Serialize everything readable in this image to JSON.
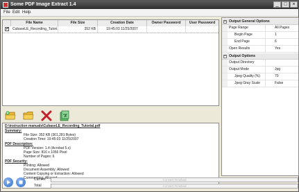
{
  "window": {
    "title": "Some PDF Image Extract 1.4"
  },
  "menu": [
    "File",
    "Edit",
    "Help"
  ],
  "grid": {
    "columns": [
      "File Name",
      "File Size",
      "Creation Date",
      "Owner Password",
      "User Password"
    ],
    "rows": [
      {
        "checked": true,
        "file_name": "CubaseLE_Recording_Tutori...",
        "file_size": "352 KB",
        "creation_date": "19:45:03 11/25/2007",
        "owner_password": "",
        "user_password": ""
      }
    ]
  },
  "toolbar": {
    "add_label": "Add",
    "open_label": "Open Folder",
    "remove_label": "Remove",
    "convert_label": "Convert"
  },
  "info": {
    "path": "D:\\instruction manuals\\CubaseLE_Recording_Tutorial.pdf",
    "summary_title": "Summary:",
    "file_size": "File Size: 352 KB (361,281 Bytes)",
    "creation_time": "Creation Time: 19:45:03 11/25/2007",
    "desc_title": "PDF Description:",
    "pdf_version": "PDF Version: 1.4 (Acrobat 5.x)",
    "page_size": "Page Size: 816 x 1056 Pixel",
    "pages": "Number of Pages: 6",
    "security_title": "PDF Security:",
    "printing": "Printing: Allowed",
    "assembly": "Document Assembly: Allowed",
    "copying": "Content Copying or Extraction: Allowed",
    "commenting": "Commenting: Allowed"
  },
  "options": {
    "general_title": "Output General Options",
    "page_range_label": "Page Range",
    "page_range_value": "All Pages",
    "begin_page_label": "Begin Page",
    "begin_page_value": "1",
    "end_page_label": "End Page",
    "end_page_value": "6",
    "open_results_label": "Open Results",
    "open_results_value": "Yes",
    "output_title": "Output Options",
    "output_dir_label": "Output Directory",
    "output_dir_value": "",
    "output_mode_label": "Output Mode",
    "output_mode_value": "Jpg",
    "jpeg_quality_label": "Jpeg Quality (%)",
    "jpeg_quality_value": "70",
    "jpeg_gray_label": "Jpeg Gray Scale",
    "jpeg_gray_value": "False"
  },
  "progress": {
    "current_label": "Current",
    "total_label": "Total",
    "current_text": "Convert Finished",
    "total_text": "Convert Finished"
  },
  "colors": {
    "title_bar": "#3c3c3c",
    "remove_red": "#c0202a",
    "play_blue": "#2f6fc9"
  }
}
